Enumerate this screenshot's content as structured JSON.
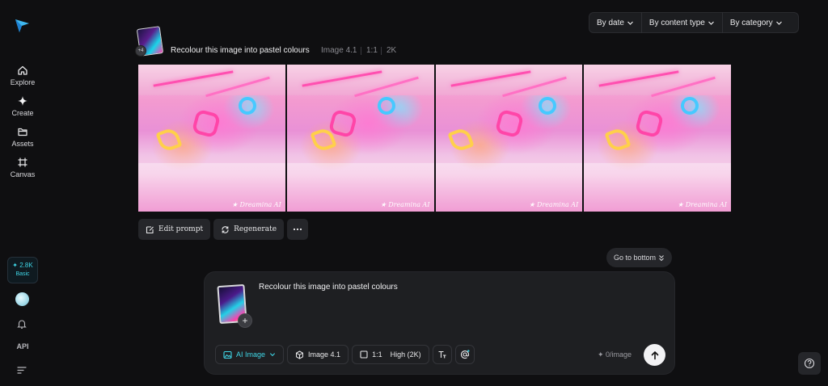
{
  "sidebar": {
    "items": [
      {
        "label": "Explore",
        "icon": "home-icon"
      },
      {
        "label": "Create",
        "icon": "sparkle-icon"
      },
      {
        "label": "Assets",
        "icon": "folder-icon"
      },
      {
        "label": "Canvas",
        "icon": "canvas-frame-icon"
      }
    ],
    "credits": {
      "amount": "2.8K",
      "plan": "Basic"
    },
    "api_label": "API"
  },
  "filters": [
    {
      "label": "By date"
    },
    {
      "label": "By content type"
    },
    {
      "label": "By category"
    }
  ],
  "generation": {
    "badge": "+4",
    "prompt": "Recolour this image into pastel colours",
    "model": "Image 4.1",
    "ratio": "1:1",
    "resolution": "2K",
    "watermark": "Dreamina AI",
    "image_count": 4
  },
  "actions": {
    "edit_prompt": "Edit prompt",
    "regenerate": "Regenerate"
  },
  "go_to_bottom": "Go to bottom",
  "composer": {
    "prompt_value": "Recolour this image into pastel colours",
    "mode": "AI Image",
    "model": "Image 4.1",
    "ratio": "1:1",
    "quality": "High (2K)",
    "quota": "0/image"
  },
  "colors": {
    "accent": "#3fd6e6",
    "background": "#0f0f11",
    "panel": "#1e1f22"
  }
}
